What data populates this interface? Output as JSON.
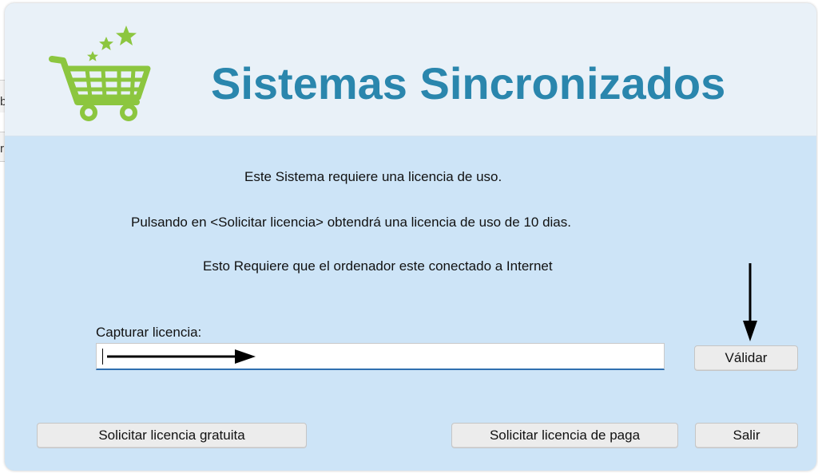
{
  "background": {
    "fragment_1_text": "b",
    "fragment_2_text": "r"
  },
  "header": {
    "brand_name": "Sistemas Sincronizados",
    "logo_icon": "shopping-cart-with-stars",
    "brand_color": "#2a86ad",
    "logo_color": "#8cc63f"
  },
  "message": {
    "line1": "Este Sistema requiere una licencia de uso.",
    "line2": "Pulsando en <Solicitar licencia> obtendrá una licencia de uso de 10 dias.",
    "line3": "Esto Requiere que el ordenador este conectado a Internet"
  },
  "license": {
    "label": "Capturar licencia:",
    "value": "",
    "validate_label": "Válidar"
  },
  "buttons": {
    "free_label": "Solicitar licencia gratuita",
    "paid_label": "Solicitar licencia de paga",
    "exit_label": "Salir"
  },
  "annotations": {
    "arrow_icon": "arrow-annotation",
    "color": "#000000"
  }
}
